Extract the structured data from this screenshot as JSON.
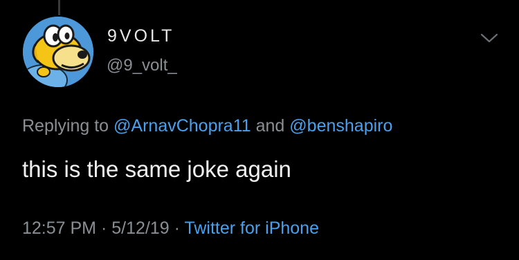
{
  "tweet": {
    "author": {
      "display_name": "9VOLT",
      "handle": "@9_volt_",
      "avatar_icon": "yellow-toad-character-avatar"
    },
    "menu_icon": "chevron-down-icon",
    "reply": {
      "prefix": "Replying to",
      "to_1": "@ArnavChopra11",
      "joiner": "and",
      "to_2": "@benshapiro"
    },
    "text": "this is the same joke again",
    "meta": {
      "time": "12:57 PM",
      "separator": "·",
      "date": "5/12/19",
      "source": "Twitter for iPhone"
    }
  },
  "colors": {
    "background": "#000000",
    "link": "#4aa0ec",
    "secondary_text": "#8a8f94",
    "primary_text": "#f1f1f1"
  }
}
